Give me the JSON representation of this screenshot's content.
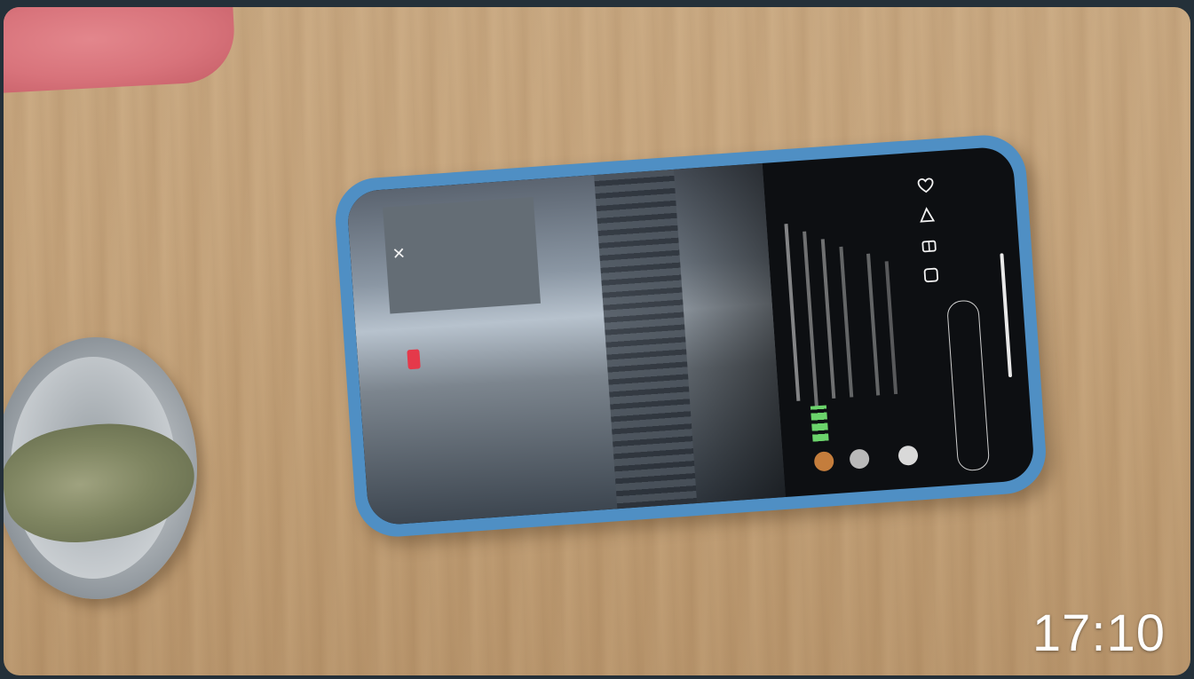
{
  "photo": {
    "timestamp": "17:10"
  },
  "phone_screen": {
    "close_glyph": "✕"
  },
  "icons": [
    "heart-icon",
    "share-icon",
    "gift-icon",
    "comment-icon",
    "close-icon"
  ],
  "colors": {
    "phone_case": "#4f8fc4",
    "live_badge": "#e5394a",
    "table": "#c5a47c"
  }
}
